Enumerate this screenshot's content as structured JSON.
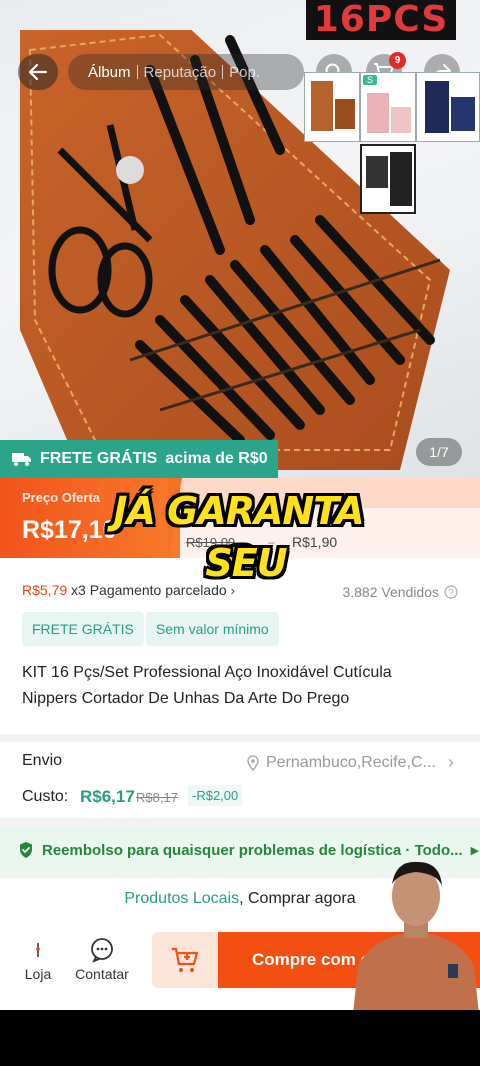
{
  "hero": {
    "banner_text": "16PCS",
    "image_counter": "1/7",
    "free_shipping_banner": {
      "label": "FRETE GRÁTIS",
      "threshold": "acima de R$0"
    }
  },
  "topbar": {
    "tabs": [
      {
        "label": "Álbum",
        "active": true
      },
      {
        "label": "Reputação",
        "active": false
      },
      {
        "label": "Pop.",
        "active": false
      }
    ],
    "cart_badge": "9",
    "thumb_label": "S"
  },
  "price": {
    "offer_label": "Preço Oferta",
    "offer_price": "R$17,10",
    "original_price": "R$19,00",
    "dash": "–",
    "install_price": "R$1,90"
  },
  "overlay": {
    "line1": "JÁ GARANTA O",
    "line2": "SEU"
  },
  "details": {
    "install_amount": "R$5,79",
    "install_text": "x3 Pagamento parcelado",
    "sold": "3.882 Vendidos",
    "tags": [
      "FRETE GRÁTIS",
      "Sem valor mínimo"
    ],
    "title": "KIT 16 Pçs/Set Professional Aço Inoxidável Cutícula Nippers Cortador De Unhas Da Arte Do Prego"
  },
  "shipping": {
    "label": "Envio",
    "location": "Pernambuco,Recife,C...",
    "cost_label": "Custo:",
    "cost": "R$6,17",
    "cost_original": "R$8,17",
    "cost_discount": "-R$2,00"
  },
  "refund": {
    "text": "Reembolso para quaisquer problemas de logística · Todo..."
  },
  "local": {
    "teal": "Produtos Locais",
    "rest": ", Comprar agora"
  },
  "bottom_bar": {
    "store": "Loja",
    "contact": "Contatar",
    "buy": "Compre com c"
  },
  "colors": {
    "accent_orange": "#f44f12",
    "teal": "#2a9d84",
    "refund_green": "#27863c"
  }
}
